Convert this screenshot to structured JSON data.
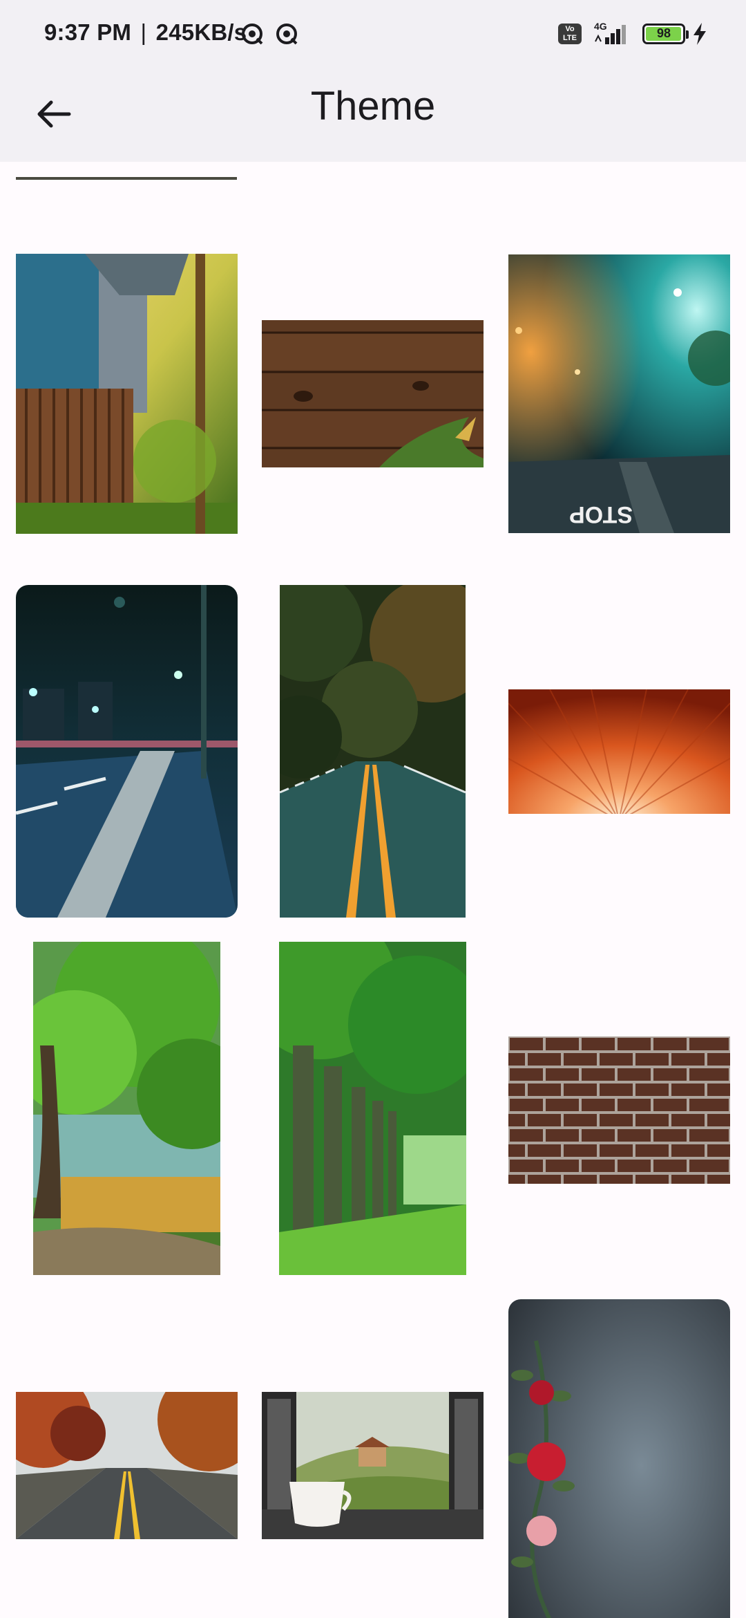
{
  "status_bar": {
    "time": "9:37 PM",
    "separator": "|",
    "speed": "245KB/s",
    "volte": "Vo\nLTE",
    "network": "4G",
    "battery": "98",
    "battery_level": 0.98
  },
  "app_bar": {
    "title": "Theme",
    "back_icon": "arrow-left-icon"
  },
  "themes": [
    {
      "name": "top-cut-theme"
    },
    {
      "name": "wooden-house-garden"
    },
    {
      "name": "wood-plank-background"
    },
    {
      "name": "night-street-stop"
    },
    {
      "name": "night-city-road"
    },
    {
      "name": "forest-road-yellow-lines"
    },
    {
      "name": "orange-sunburst-pattern"
    },
    {
      "name": "green-tree-meadow"
    },
    {
      "name": "green-tree-tunnel"
    },
    {
      "name": "brick-wall"
    },
    {
      "name": "autumn-road"
    },
    {
      "name": "window-coffee-cup"
    },
    {
      "name": "dark-wall-red-roses"
    }
  ]
}
